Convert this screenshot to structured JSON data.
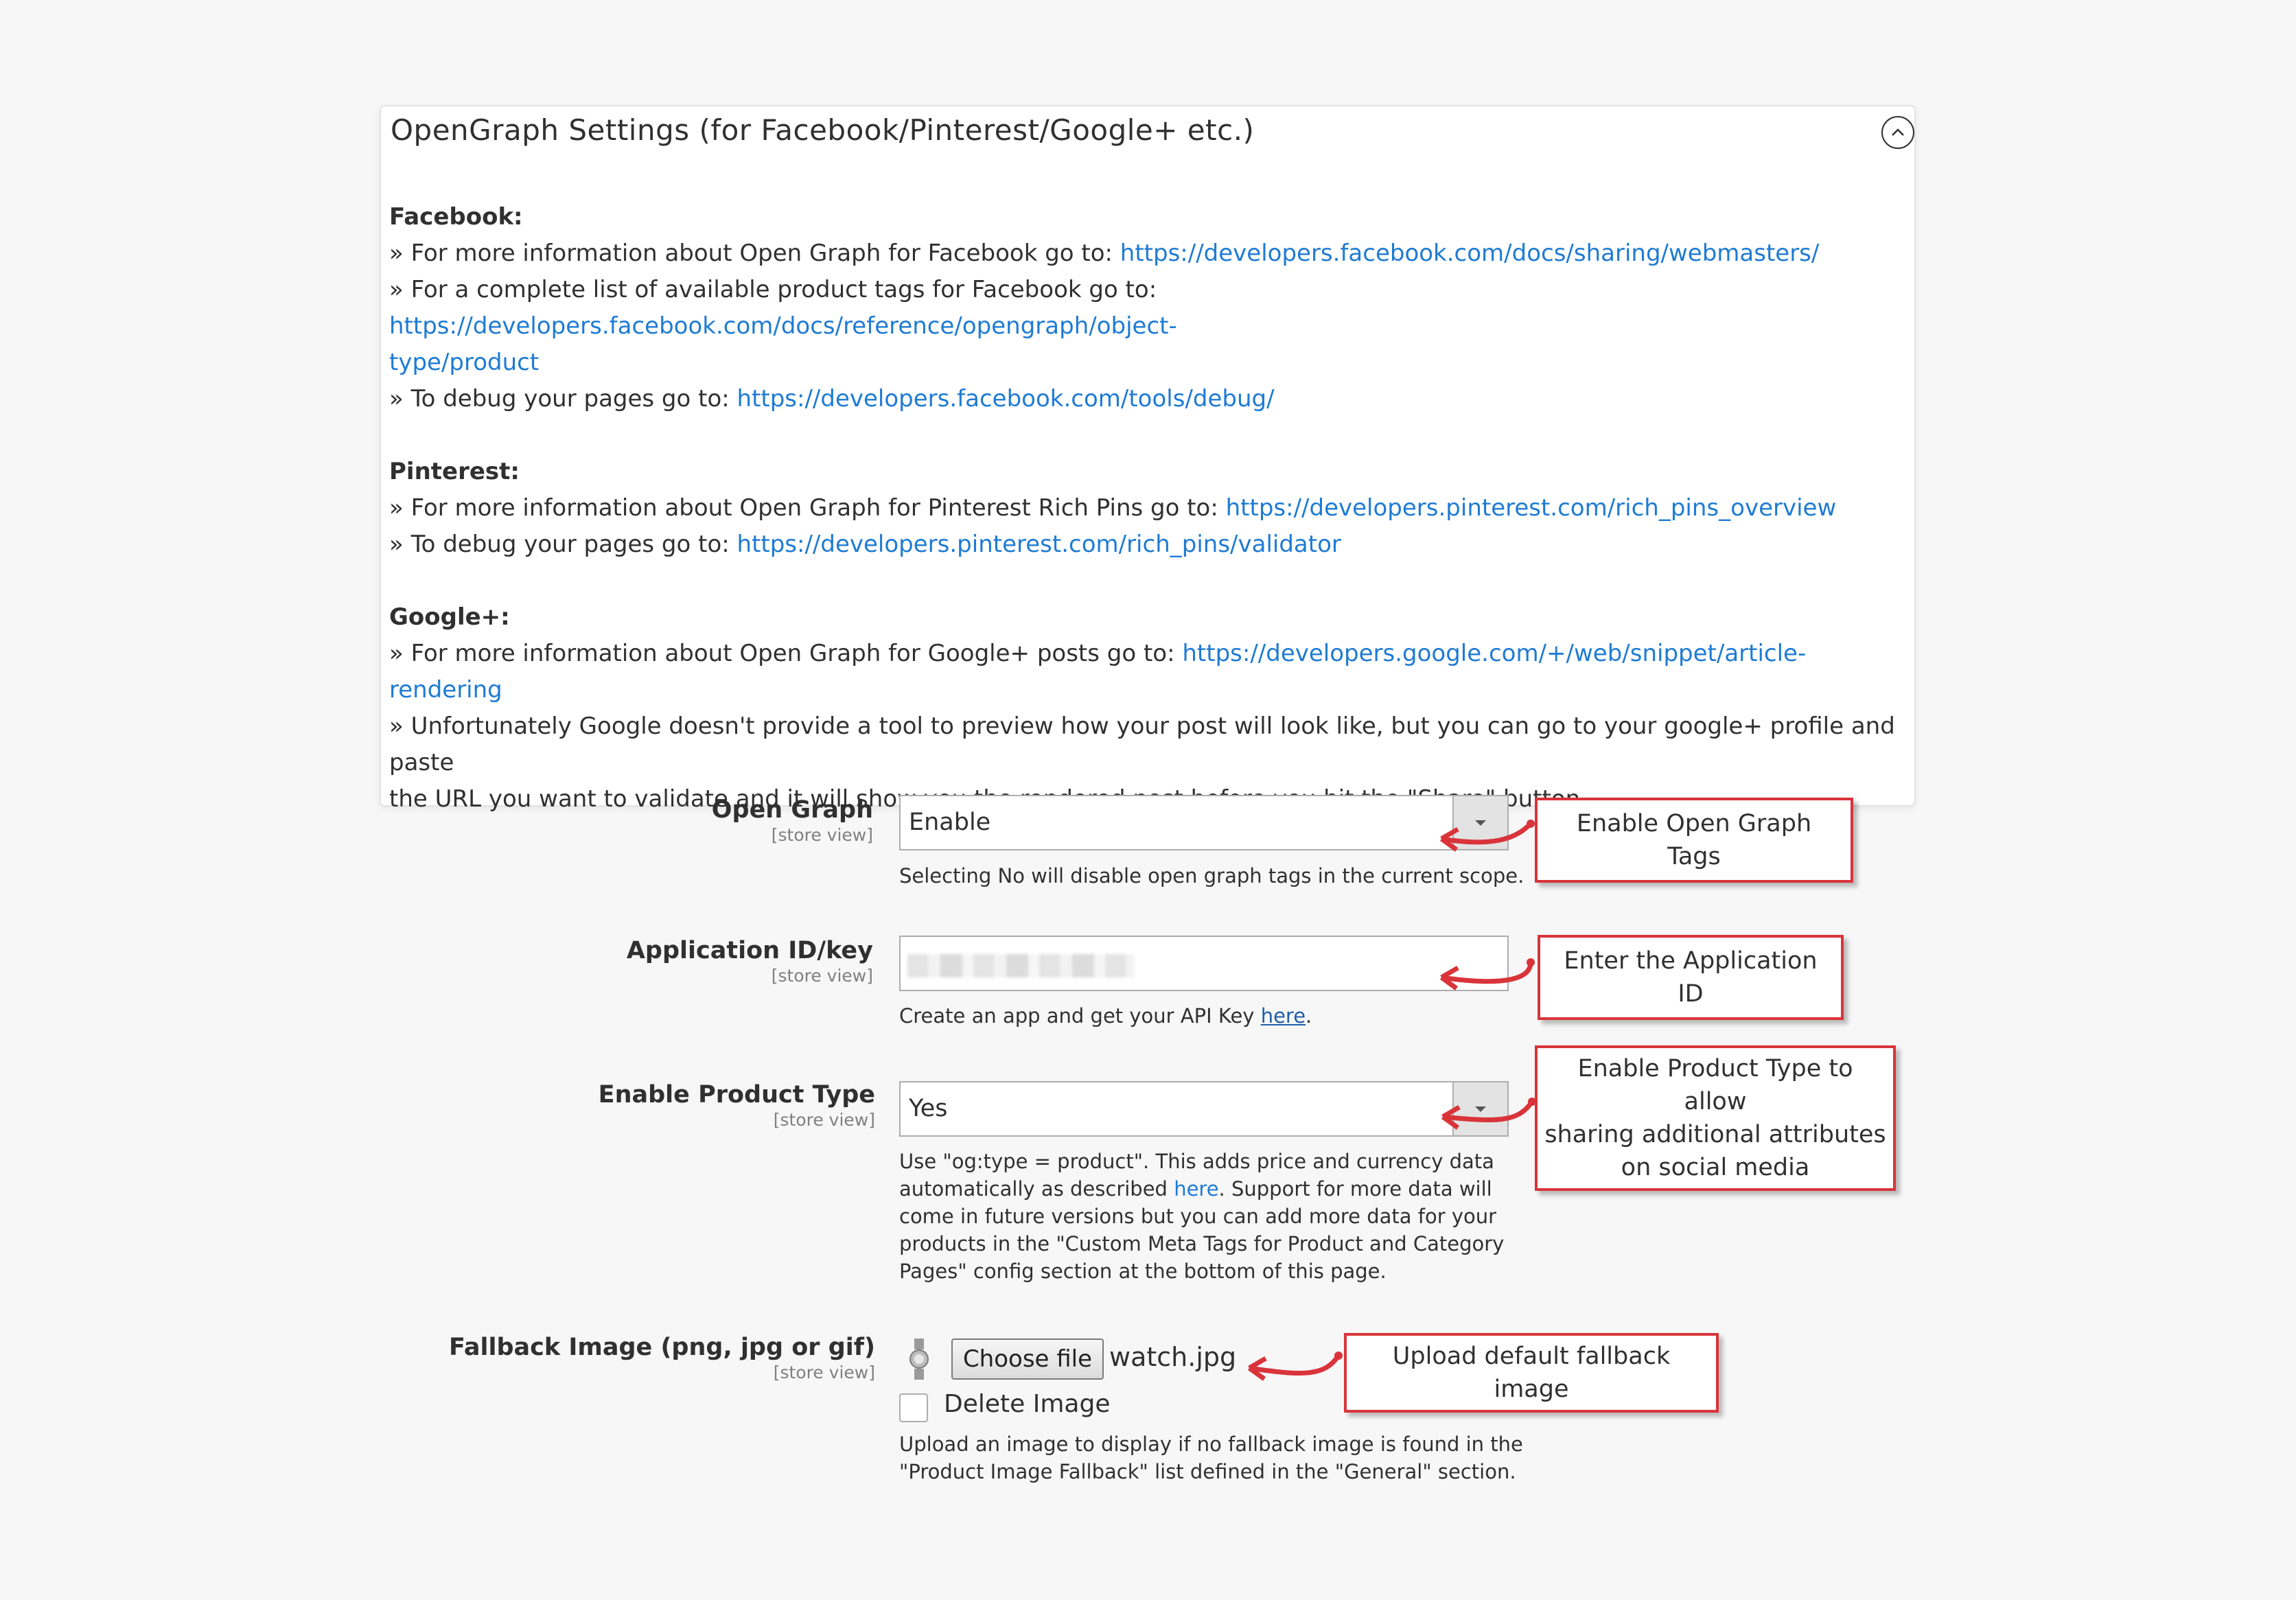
{
  "panel": {
    "title": "OpenGraph Settings (for Facebook/Pinterest/Google+ etc.)",
    "collapse_icon": "chevron-up-circle-icon"
  },
  "info": {
    "facebook": {
      "heading": "Facebook:",
      "line1_text": "» For more information about Open Graph for Facebook go to: ",
      "line1_link": "https://developers.facebook.com/docs/sharing/webmasters/",
      "line2_text": "» For a complete list of available product tags for Facebook go to: ",
      "line2_link_a": "https://developers.facebook.com/docs/reference/opengraph/object-",
      "line2_link_b": "type/product",
      "line3_text": "» To debug your pages go to: ",
      "line3_link": "https://developers.facebook.com/tools/debug/"
    },
    "pinterest": {
      "heading": "Pinterest:",
      "line1_text": "» For more information about Open Graph for Pinterest Rich Pins go to: ",
      "line1_link": "https://developers.pinterest.com/rich_pins_overview",
      "line2_text": "» To debug your pages go to: ",
      "line2_link": "https://developers.pinterest.com/rich_pins/validator"
    },
    "google": {
      "heading": "Google+:",
      "line1_text": "» For more information about Open Graph for Google+ posts go to: ",
      "line1_link": "https://developers.google.com/+/web/snippet/article-rendering",
      "line2": "» Unfortunately Google doesn't provide a tool to preview how your post will look like, but you can go to your google+ profile and paste",
      "line3": "the URL you want to validate and it will show you the rendered post before you hit the \"Share\" button."
    }
  },
  "fields": {
    "open_graph": {
      "label": "Open Graph",
      "scope": "[store view]",
      "value": "Enable",
      "note": "Selecting No will disable open graph tags in the current scope.",
      "callout": "Enable Open Graph Tags"
    },
    "app_id": {
      "label": "Application ID/key",
      "scope": "[store view]",
      "note_before": "Create an app and get your API Key ",
      "note_link": "here",
      "note_after": ".",
      "callout": "Enter the Application ID"
    },
    "product_type": {
      "label": "Enable Product Type",
      "scope": "[store view]",
      "value": "Yes",
      "note_l1": "Use \"og:type = product\". This adds price and currency data",
      "note_l2a": "automatically as described ",
      "note_l2_link": "here",
      "note_l2b": ". Support for more data will",
      "note_l3": "come in future versions but you can add more data for your",
      "note_l4": "products in the \"Custom Meta Tags for Product and Category",
      "note_l5": "Pages\" config section at the bottom of this page.",
      "callout_l1": "Enable Product Type to allow",
      "callout_l2": "sharing additional attributes",
      "callout_l3": "on social media"
    },
    "fallback_image": {
      "label": "Fallback Image (png, jpg or gif)",
      "scope": "[store view]",
      "button": "Choose file",
      "file_name": "watch.jpg",
      "delete_label": "Delete Image",
      "note_l1": "Upload an image to display if no fallback image is found in the",
      "note_l2": "\"Product Image Fallback\" list defined in the \"General\" section.",
      "callout": "Upload default fallback image"
    }
  },
  "colors": {
    "link": "#1e7bd4",
    "callout_border": "#d9343a",
    "arrow": "#d9343a"
  }
}
